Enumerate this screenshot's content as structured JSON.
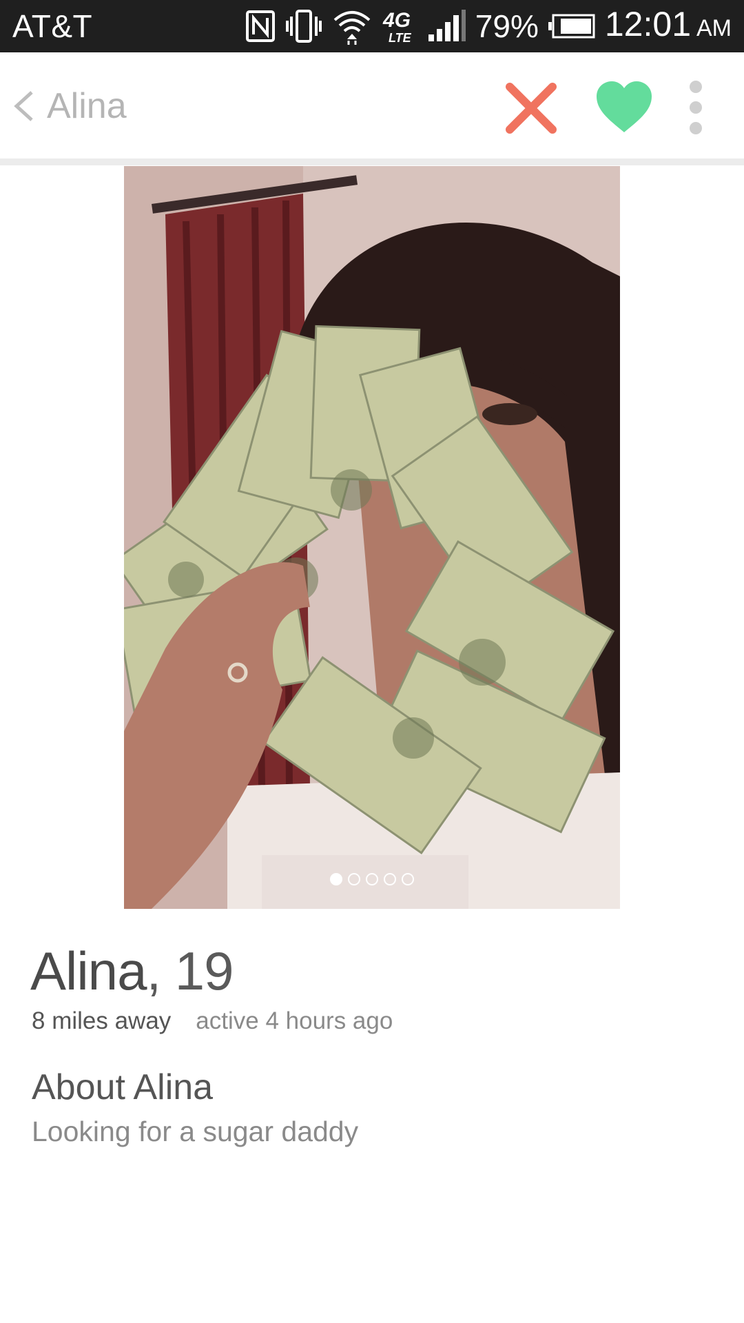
{
  "status_bar": {
    "carrier": "AT&T",
    "network": "4G LTE",
    "battery_percent": "79%",
    "time": "12:01",
    "ampm": "AM",
    "icons": [
      "nfc-icon",
      "vibrate-icon",
      "wifi-icon",
      "lte-icon",
      "signal-icon",
      "battery-icon"
    ]
  },
  "header": {
    "title": "Alina",
    "back_icon": "chevron-left-icon",
    "actions": [
      "close-icon",
      "heart-icon",
      "more-vertical-icon"
    ]
  },
  "colors": {
    "nope": "#f0735f",
    "like": "#63dc9c",
    "muted": "#b5b5b5",
    "text_dark": "#4a4a4a",
    "text_light": "#8a8a8a"
  },
  "photo": {
    "count": 5,
    "active_index": 0
  },
  "profile": {
    "name": "Alina",
    "age_text": ", 19",
    "distance": "8 miles away",
    "last_active": "active 4 hours ago",
    "about_title": "About Alina",
    "about_text": "Looking for a sugar daddy"
  }
}
